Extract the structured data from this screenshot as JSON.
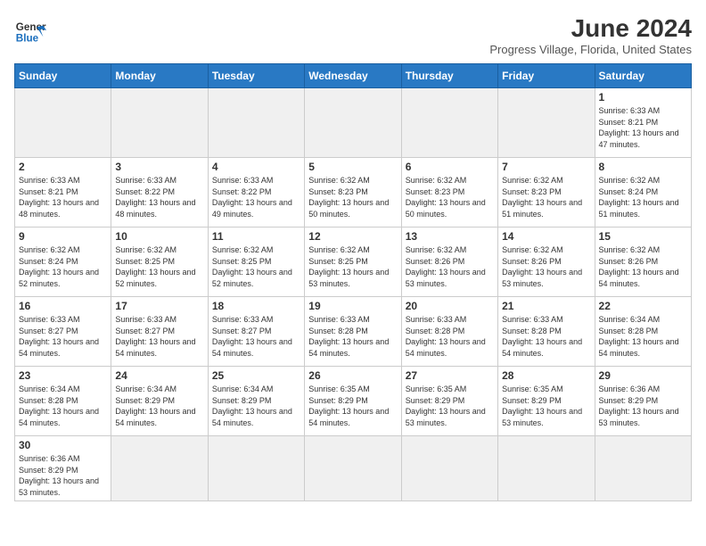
{
  "header": {
    "logo_general": "General",
    "logo_blue": "Blue",
    "month_title": "June 2024",
    "location": "Progress Village, Florida, United States"
  },
  "days_of_week": [
    "Sunday",
    "Monday",
    "Tuesday",
    "Wednesday",
    "Thursday",
    "Friday",
    "Saturday"
  ],
  "weeks": [
    [
      {
        "day": "",
        "info": "",
        "empty": true
      },
      {
        "day": "",
        "info": "",
        "empty": true
      },
      {
        "day": "",
        "info": "",
        "empty": true
      },
      {
        "day": "",
        "info": "",
        "empty": true
      },
      {
        "day": "",
        "info": "",
        "empty": true
      },
      {
        "day": "",
        "info": "",
        "empty": true
      },
      {
        "day": "1",
        "info": "Sunrise: 6:33 AM\nSunset: 8:21 PM\nDaylight: 13 hours and 47 minutes."
      }
    ],
    [
      {
        "day": "2",
        "info": "Sunrise: 6:33 AM\nSunset: 8:21 PM\nDaylight: 13 hours and 48 minutes."
      },
      {
        "day": "3",
        "info": "Sunrise: 6:33 AM\nSunset: 8:22 PM\nDaylight: 13 hours and 48 minutes."
      },
      {
        "day": "4",
        "info": "Sunrise: 6:33 AM\nSunset: 8:22 PM\nDaylight: 13 hours and 49 minutes."
      },
      {
        "day": "5",
        "info": "Sunrise: 6:32 AM\nSunset: 8:23 PM\nDaylight: 13 hours and 50 minutes."
      },
      {
        "day": "6",
        "info": "Sunrise: 6:32 AM\nSunset: 8:23 PM\nDaylight: 13 hours and 50 minutes."
      },
      {
        "day": "7",
        "info": "Sunrise: 6:32 AM\nSunset: 8:23 PM\nDaylight: 13 hours and 51 minutes."
      },
      {
        "day": "8",
        "info": "Sunrise: 6:32 AM\nSunset: 8:24 PM\nDaylight: 13 hours and 51 minutes."
      }
    ],
    [
      {
        "day": "9",
        "info": "Sunrise: 6:32 AM\nSunset: 8:24 PM\nDaylight: 13 hours and 52 minutes."
      },
      {
        "day": "10",
        "info": "Sunrise: 6:32 AM\nSunset: 8:25 PM\nDaylight: 13 hours and 52 minutes."
      },
      {
        "day": "11",
        "info": "Sunrise: 6:32 AM\nSunset: 8:25 PM\nDaylight: 13 hours and 52 minutes."
      },
      {
        "day": "12",
        "info": "Sunrise: 6:32 AM\nSunset: 8:25 PM\nDaylight: 13 hours and 53 minutes."
      },
      {
        "day": "13",
        "info": "Sunrise: 6:32 AM\nSunset: 8:26 PM\nDaylight: 13 hours and 53 minutes."
      },
      {
        "day": "14",
        "info": "Sunrise: 6:32 AM\nSunset: 8:26 PM\nDaylight: 13 hours and 53 minutes."
      },
      {
        "day": "15",
        "info": "Sunrise: 6:32 AM\nSunset: 8:26 PM\nDaylight: 13 hours and 54 minutes."
      }
    ],
    [
      {
        "day": "16",
        "info": "Sunrise: 6:33 AM\nSunset: 8:27 PM\nDaylight: 13 hours and 54 minutes."
      },
      {
        "day": "17",
        "info": "Sunrise: 6:33 AM\nSunset: 8:27 PM\nDaylight: 13 hours and 54 minutes."
      },
      {
        "day": "18",
        "info": "Sunrise: 6:33 AM\nSunset: 8:27 PM\nDaylight: 13 hours and 54 minutes."
      },
      {
        "day": "19",
        "info": "Sunrise: 6:33 AM\nSunset: 8:28 PM\nDaylight: 13 hours and 54 minutes."
      },
      {
        "day": "20",
        "info": "Sunrise: 6:33 AM\nSunset: 8:28 PM\nDaylight: 13 hours and 54 minutes."
      },
      {
        "day": "21",
        "info": "Sunrise: 6:33 AM\nSunset: 8:28 PM\nDaylight: 13 hours and 54 minutes."
      },
      {
        "day": "22",
        "info": "Sunrise: 6:34 AM\nSunset: 8:28 PM\nDaylight: 13 hours and 54 minutes."
      }
    ],
    [
      {
        "day": "23",
        "info": "Sunrise: 6:34 AM\nSunset: 8:28 PM\nDaylight: 13 hours and 54 minutes."
      },
      {
        "day": "24",
        "info": "Sunrise: 6:34 AM\nSunset: 8:29 PM\nDaylight: 13 hours and 54 minutes."
      },
      {
        "day": "25",
        "info": "Sunrise: 6:34 AM\nSunset: 8:29 PM\nDaylight: 13 hours and 54 minutes."
      },
      {
        "day": "26",
        "info": "Sunrise: 6:35 AM\nSunset: 8:29 PM\nDaylight: 13 hours and 54 minutes."
      },
      {
        "day": "27",
        "info": "Sunrise: 6:35 AM\nSunset: 8:29 PM\nDaylight: 13 hours and 53 minutes."
      },
      {
        "day": "28",
        "info": "Sunrise: 6:35 AM\nSunset: 8:29 PM\nDaylight: 13 hours and 53 minutes."
      },
      {
        "day": "29",
        "info": "Sunrise: 6:36 AM\nSunset: 8:29 PM\nDaylight: 13 hours and 53 minutes."
      }
    ],
    [
      {
        "day": "30",
        "info": "Sunrise: 6:36 AM\nSunset: 8:29 PM\nDaylight: 13 hours and 53 minutes.",
        "last": true
      },
      {
        "day": "",
        "info": "",
        "empty": true,
        "last": true
      },
      {
        "day": "",
        "info": "",
        "empty": true,
        "last": true
      },
      {
        "day": "",
        "info": "",
        "empty": true,
        "last": true
      },
      {
        "day": "",
        "info": "",
        "empty": true,
        "last": true
      },
      {
        "day": "",
        "info": "",
        "empty": true,
        "last": true
      },
      {
        "day": "",
        "info": "",
        "empty": true,
        "last": true
      }
    ]
  ]
}
